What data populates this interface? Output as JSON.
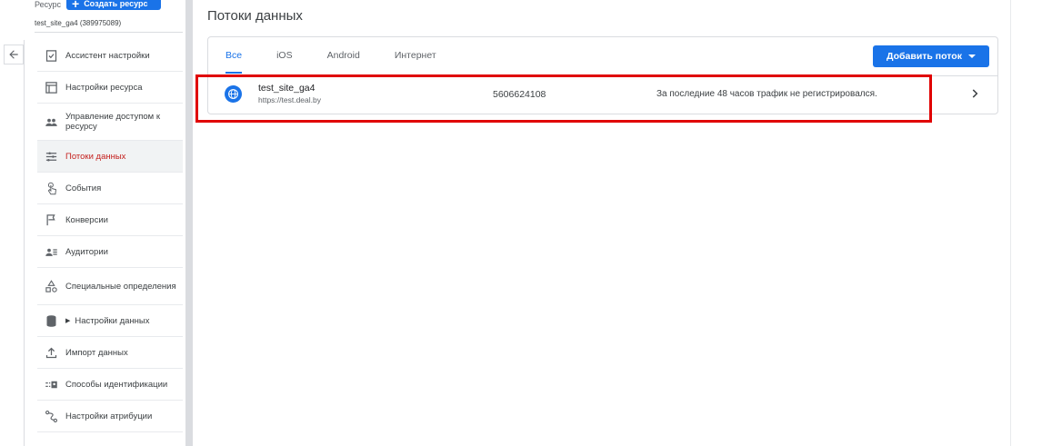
{
  "header": {
    "resource_label": "Ресурс",
    "create_button": "Создать ресурс",
    "property_id": "test_site_ga4 (389975089)"
  },
  "sidebar": {
    "items": [
      {
        "label": "Ассистент настройки",
        "icon": "checklist-icon"
      },
      {
        "label": "Настройки ресурса",
        "icon": "layout-icon"
      },
      {
        "label": "Управление доступом к ресурсу",
        "icon": "people-icon"
      },
      {
        "label": "Потоки данных",
        "icon": "streams-icon",
        "active": true
      },
      {
        "label": "События",
        "icon": "touch-icon"
      },
      {
        "label": "Конверсии",
        "icon": "flag-icon"
      },
      {
        "label": "Аудитории",
        "icon": "audience-icon"
      },
      {
        "label": "Специальные определения",
        "icon": "shapes-icon"
      },
      {
        "label": "Настройки данных",
        "icon": "database-icon"
      },
      {
        "label": "Импорт данных",
        "icon": "upload-icon"
      },
      {
        "label": "Способы идентификации",
        "icon": "identity-icon"
      },
      {
        "label": "Настройки атрибуции",
        "icon": "attribution-icon"
      }
    ]
  },
  "main": {
    "title": "Потоки данных",
    "tabs": [
      {
        "label": "Все",
        "active": true
      },
      {
        "label": "iOS"
      },
      {
        "label": "Android"
      },
      {
        "label": "Интернет"
      }
    ],
    "add_stream_button": "Добавить поток",
    "streams": [
      {
        "name": "test_site_ga4",
        "url": "https://test.deal.by",
        "id": "5606624108",
        "status": "За последние 48 часов трафик не регистрировался.",
        "icon": "globe-icon"
      }
    ]
  },
  "colors": {
    "accent": "#1a73e8",
    "active_nav": "#c5221f",
    "highlight": "#e00000"
  }
}
